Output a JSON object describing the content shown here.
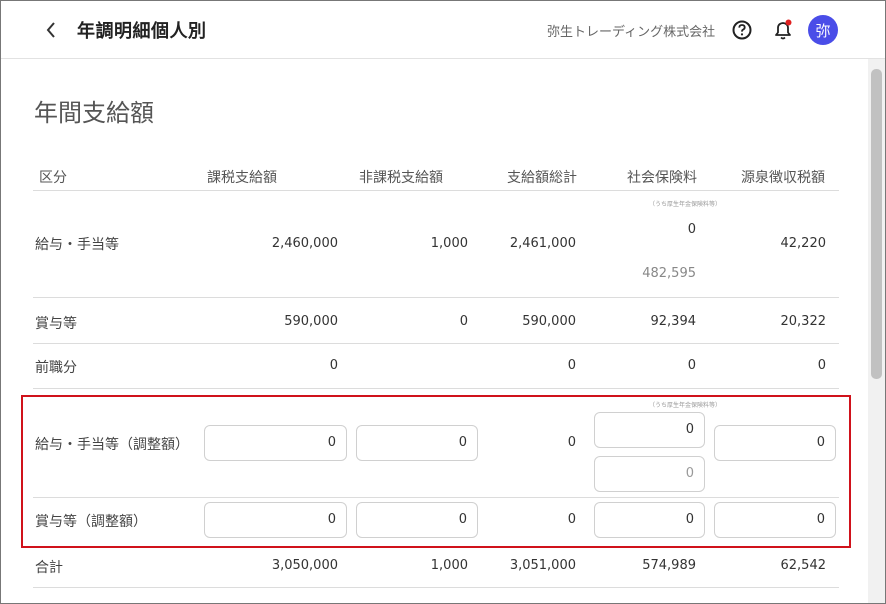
{
  "header": {
    "title": "年調明細個人別",
    "company": "弥生トレーディング株式会社",
    "avatar_text": "弥"
  },
  "section_title": "年間支給額",
  "columns": [
    "区分",
    "課税支給額",
    "非課税支給額",
    "支給額総計",
    "社会保険料",
    "源泉徴収税額"
  ],
  "small_note": "（うち厚生年金保険料等）",
  "rows": {
    "salary": {
      "label": "給与・手当等",
      "taxable": "2,460,000",
      "nontaxable": "1,000",
      "total": "2,461,000",
      "social": "0",
      "social_sub": "482,595",
      "withholding": "42,220"
    },
    "bonus": {
      "label": "賞与等",
      "taxable": "590,000",
      "nontaxable": "0",
      "total": "590,000",
      "social": "92,394",
      "withholding": "20,322"
    },
    "previous": {
      "label": "前職分",
      "taxable": "0",
      "total": "0",
      "social": "0",
      "withholding": "0"
    },
    "salary_adj": {
      "label": "給与・手当等（調整額）",
      "taxable": "0",
      "nontaxable": "0",
      "total": "0",
      "social": "0",
      "social_sub": "0",
      "withholding": "0"
    },
    "bonus_adj": {
      "label": "賞与等（調整額）",
      "taxable": "0",
      "nontaxable": "0",
      "total": "0",
      "social": "0",
      "withholding": "0"
    },
    "sum": {
      "label": "合計",
      "taxable": "3,050,000",
      "nontaxable": "1,000",
      "total": "3,051,000",
      "social": "574,989",
      "withholding": "62,542"
    }
  }
}
